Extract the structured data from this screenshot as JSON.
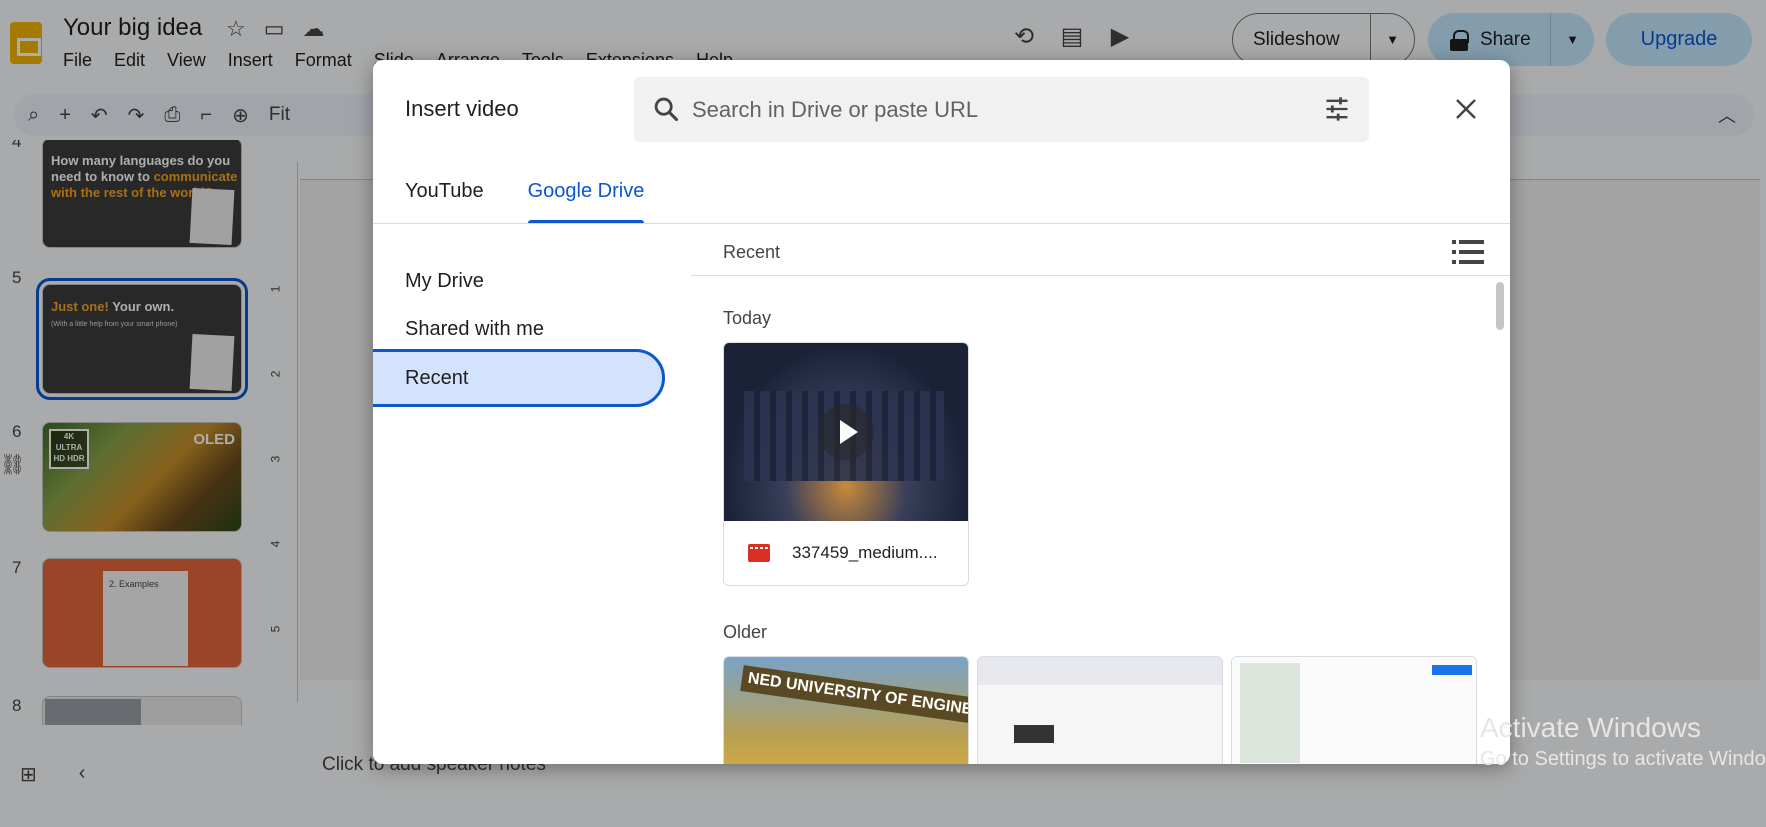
{
  "app": {
    "doc_title": "Your big idea",
    "menu": [
      "File",
      "Edit",
      "View",
      "Insert",
      "Format",
      "Slide",
      "Arrange",
      "Tools",
      "Extensions",
      "Help"
    ],
    "slideshow_label": "Slideshow",
    "share_label": "Share",
    "upgrade_label": "Upgrade",
    "zoom_label": "Fit",
    "speaker_notes_placeholder": "Click to add speaker notes",
    "ruler_marks": [
      "1",
      "2",
      "3",
      "4",
      "5"
    ]
  },
  "filmstrip": {
    "slides": [
      {
        "num": "4",
        "title_white": "How many languages do you need to know to",
        "title_orange": "communicate with the rest of the world?"
      },
      {
        "num": "5",
        "title_orange": "Just one!",
        "title_white": "Your own.",
        "subtitle": "(With a little help from your smart phone)"
      },
      {
        "num": "6",
        "badge": "4K ULTRA HD HDR",
        "label": "OLED"
      },
      {
        "num": "7",
        "title": "2. Examples"
      },
      {
        "num": "8"
      }
    ]
  },
  "dialog": {
    "title": "Insert video",
    "search_placeholder": "Search in Drive or paste URL",
    "tabs": [
      {
        "label": "YouTube",
        "active": false
      },
      {
        "label": "Google Drive",
        "active": true
      }
    ],
    "nav": [
      {
        "label": "My Drive",
        "active": false
      },
      {
        "label": "Shared with me",
        "active": false
      },
      {
        "label": "Recent",
        "active": true
      }
    ],
    "header_label": "Recent",
    "sections": {
      "today": "Today",
      "older": "Older"
    },
    "today_files": [
      {
        "name": "337459_medium...."
      }
    ],
    "older_files": [
      {
        "banner": "NED UNIVERSITY OF ENGINEERING & TECHNOLOGY"
      },
      {},
      {}
    ]
  },
  "watermark": {
    "line1": "Activate Windows",
    "line2": "Go to Settings to activate Windows."
  },
  "colors": {
    "accent": "#0b57d0",
    "nav_selected_bg": "#d3e3fd",
    "share_bg": "#c2e7ff",
    "video_icon": "#d93025"
  }
}
